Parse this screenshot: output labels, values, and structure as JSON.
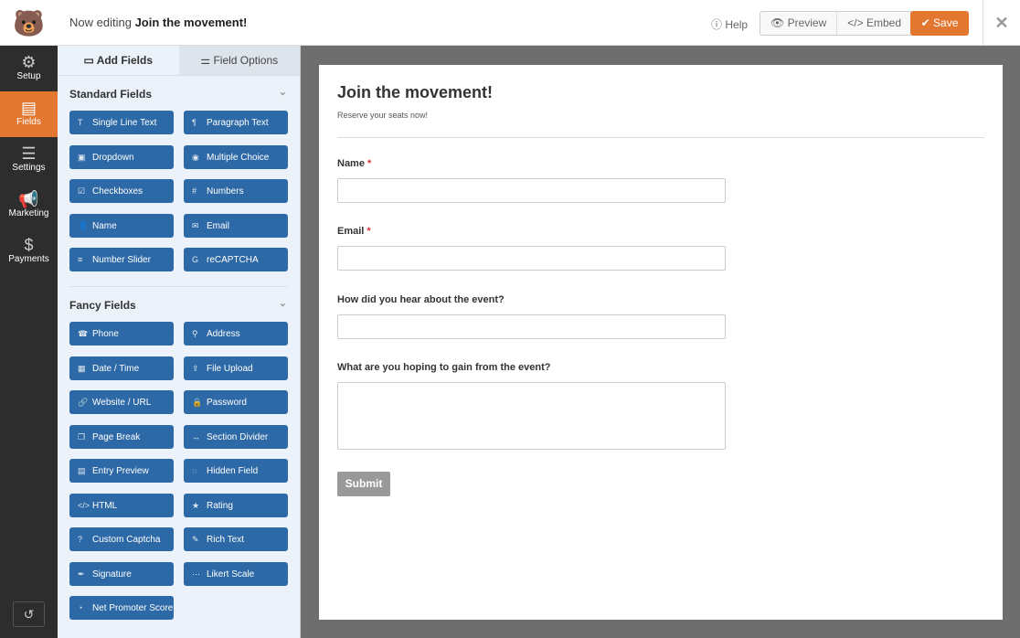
{
  "header": {
    "prefix": "Now editing",
    "form_name": "Join the movement!",
    "help": "Help",
    "preview": "Preview",
    "embed": "Embed",
    "save": "Save"
  },
  "nav": [
    {
      "label": "Setup",
      "icon": "⚙"
    },
    {
      "label": "Fields",
      "icon": "▤"
    },
    {
      "label": "Settings",
      "icon": "☰"
    },
    {
      "label": "Marketing",
      "icon": "📢"
    },
    {
      "label": "Payments",
      "icon": "$"
    }
  ],
  "panel": {
    "tabs": [
      "Add Fields",
      "Field Options"
    ],
    "standard_title": "Standard Fields",
    "standard": [
      {
        "label": "Single Line Text",
        "icon": "T"
      },
      {
        "label": "Paragraph Text",
        "icon": "¶"
      },
      {
        "label": "Dropdown",
        "icon": "▣"
      },
      {
        "label": "Multiple Choice",
        "icon": "◉"
      },
      {
        "label": "Checkboxes",
        "icon": "☑"
      },
      {
        "label": "Numbers",
        "icon": "#"
      },
      {
        "label": "Name",
        "icon": "👤"
      },
      {
        "label": "Email",
        "icon": "✉"
      },
      {
        "label": "Number Slider",
        "icon": "≡"
      },
      {
        "label": "reCAPTCHA",
        "icon": "G"
      }
    ],
    "fancy_title": "Fancy Fields",
    "fancy": [
      {
        "label": "Phone",
        "icon": "☎"
      },
      {
        "label": "Address",
        "icon": "⚲"
      },
      {
        "label": "Date / Time",
        "icon": "▦"
      },
      {
        "label": "File Upload",
        "icon": "⇪"
      },
      {
        "label": "Website / URL",
        "icon": "🔗"
      },
      {
        "label": "Password",
        "icon": "🔒"
      },
      {
        "label": "Page Break",
        "icon": "❐"
      },
      {
        "label": "Section Divider",
        "icon": "↔"
      },
      {
        "label": "Entry Preview",
        "icon": "▤"
      },
      {
        "label": "Hidden Field",
        "icon": "◌"
      },
      {
        "label": "HTML",
        "icon": "</>"
      },
      {
        "label": "Rating",
        "icon": "★"
      },
      {
        "label": "Custom Captcha",
        "icon": "?"
      },
      {
        "label": "Rich Text",
        "icon": "✎"
      },
      {
        "label": "Signature",
        "icon": "✒"
      },
      {
        "label": "Likert Scale",
        "icon": "⋯"
      },
      {
        "label": "Net Promoter Score",
        "icon": "◔"
      }
    ]
  },
  "form": {
    "title": "Join the movement!",
    "description": "Reserve your seats now!",
    "fields": [
      {
        "label": "Name",
        "required": "*"
      },
      {
        "label": "Email",
        "required": "*"
      },
      {
        "label": "How did you hear about the event?"
      },
      {
        "label": "What are you hoping to gain from the event?"
      }
    ],
    "submit": "Submit"
  }
}
